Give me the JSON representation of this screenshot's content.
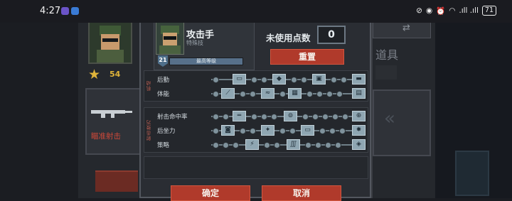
{
  "status_bar": {
    "time": "4:27",
    "battery": "71",
    "signal_text": ".ıll .ıll"
  },
  "background": {
    "star_count": "54",
    "precise_shot": "瞄准射击",
    "items_title": "道具"
  },
  "dialog": {
    "role_name": "攻击手",
    "role_subtitle": "特殊技",
    "level": "21",
    "level_bar_text": "最高等级",
    "unused_points_label": "未使用点数",
    "unused_points_value": "0",
    "reset_label": "重置",
    "confirm_label": "确定",
    "cancel_label": "取消",
    "sections": [
      {
        "label": "机动",
        "rows": [
          {
            "label": "后勤",
            "icons": [
              "ammo-icon",
              "crate-icon",
              "gear-icon",
              "supply-icon"
            ]
          },
          {
            "label": "体能",
            "icons": [
              "boot-icon",
              "run-icon",
              "armor-icon",
              "pack-icon"
            ]
          }
        ]
      },
      {
        "label": "射击技巧",
        "rows": [
          {
            "label": "射击命中率",
            "icons": [
              "rifle-icon",
              "scope-icon",
              "crosshair-icon"
            ]
          },
          {
            "label": "后坐力",
            "icons": [
              "helmet-icon",
              "grenade-icon",
              "shot-icon",
              "fire-icon"
            ]
          },
          {
            "label": "策略",
            "icons": [
              "bolt-icon",
              "claw-icon",
              "shield-icon"
            ]
          }
        ]
      }
    ]
  },
  "colors": {
    "accent_red": "#b03a2b",
    "panel": "#2a2d33",
    "icon_tint": "#8fa6b2",
    "gold": "#e0b43a"
  }
}
